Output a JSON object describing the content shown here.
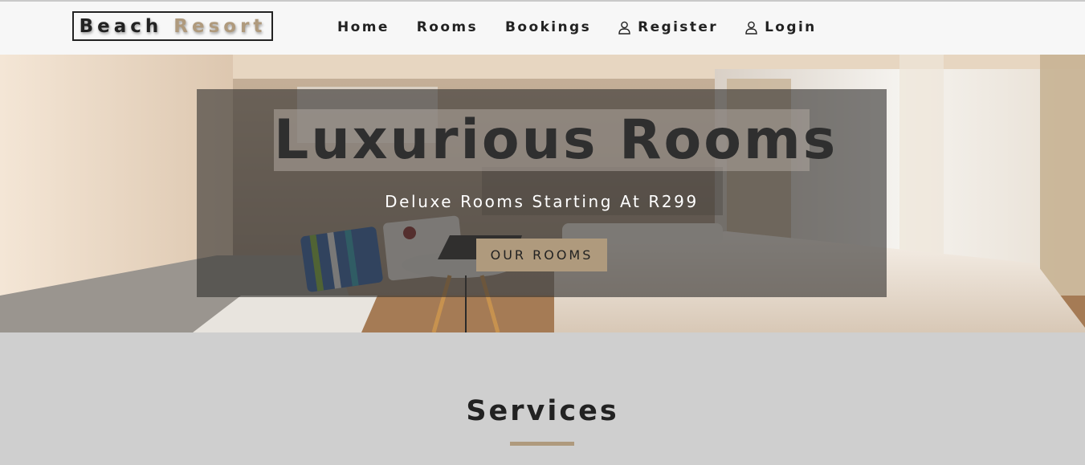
{
  "brand": {
    "word1": "Beach",
    "word2": "Resort",
    "accent_color": "#af9a7d"
  },
  "nav": {
    "items": [
      {
        "label": "Home",
        "icon": null
      },
      {
        "label": "Rooms",
        "icon": null
      },
      {
        "label": "Bookings",
        "icon": null
      },
      {
        "label": "Register",
        "icon": "user-icon"
      },
      {
        "label": "Login",
        "icon": "user-icon"
      }
    ]
  },
  "hero": {
    "title": "Luxurious Rooms",
    "subtitle": "Deluxe Rooms Starting At R299",
    "button_label": "OUR ROOMS"
  },
  "services": {
    "title": "Services"
  }
}
